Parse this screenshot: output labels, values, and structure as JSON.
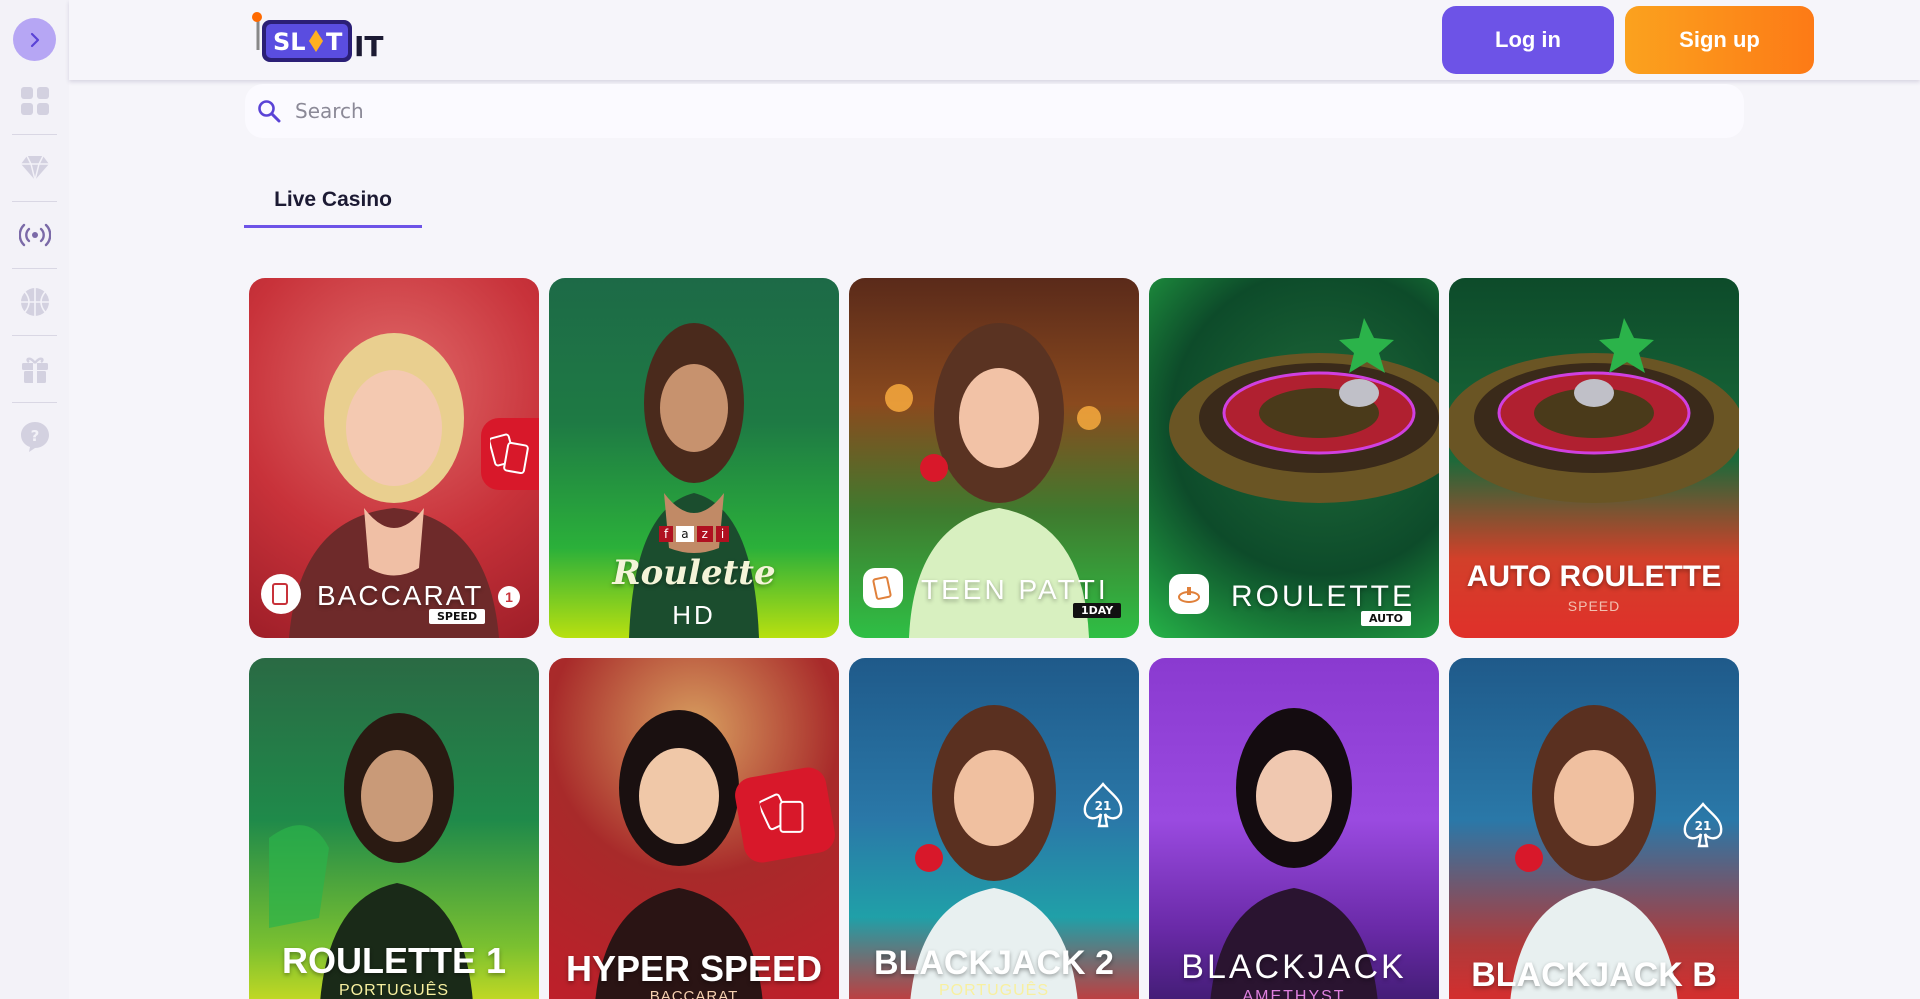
{
  "brand": {
    "logo_text": "SL",
    "logo_text2": "T",
    "logo_suffix": "IT"
  },
  "colors": {
    "primary": "#6d53e7",
    "signup_start": "#fba21e",
    "signup_end": "#fd7a16",
    "background": "#f6f5fa"
  },
  "header": {
    "login_label": "Log in",
    "signup_label": "Sign up"
  },
  "search": {
    "placeholder": "Search",
    "value": ""
  },
  "sidebar": {
    "toggle_icon": "chevron-right-icon",
    "items": [
      {
        "icon": "grid-icon"
      },
      {
        "icon": "diamond-icon"
      },
      {
        "icon": "live-broadcast-icon"
      },
      {
        "icon": "sports-ball-icon"
      },
      {
        "icon": "gift-icon"
      },
      {
        "icon": "help-icon"
      }
    ]
  },
  "tabs": [
    {
      "label": "Live Casino",
      "active": true
    }
  ],
  "games": [
    {
      "title": "BACCARAT",
      "tag": "SPEED",
      "number": "1"
    },
    {
      "title": "Roulette",
      "subtitle": "HD",
      "brand": [
        "f",
        "a",
        "z",
        "i"
      ]
    },
    {
      "title": "TEEN PATTI",
      "tag": "1DAY"
    },
    {
      "title": "ROULETTE",
      "tag": "AUTO"
    },
    {
      "title": "AUTO ROULETTE",
      "subtitle": "SPEED"
    },
    {
      "title": "ROULETTE 1",
      "subtitle": "PORTUGUÊS"
    },
    {
      "title": "HYPER SPEED",
      "subtitle": "BACCARAT"
    },
    {
      "title": "BLACKJACK 2",
      "subtitle": "PORTUGUÊS"
    },
    {
      "title": "BLACKJACK",
      "subtitle": "AMETHYST"
    },
    {
      "title": "BLACKJACK B"
    }
  ]
}
